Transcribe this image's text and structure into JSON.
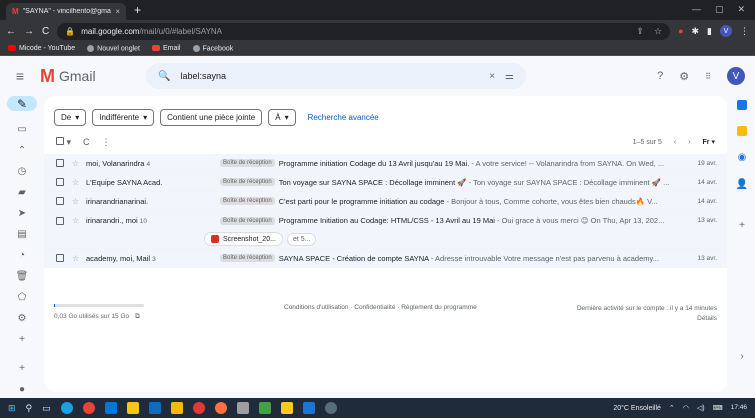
{
  "browser": {
    "tab_title": "\"SAYNA\" - vincilhento@gmail.co",
    "tab_close": "×",
    "new_tab": "+",
    "url_host": "mail.google.com",
    "url_path": "/mail/u/0/#label/SAYNA",
    "nav_back": "←",
    "nav_forward": "→",
    "nav_reload": "C",
    "profile_initial": "V",
    "bookmarks": [
      {
        "label": "Micode - YouTube",
        "color": "#ff0000"
      },
      {
        "label": "Nouvel onglet",
        "color": "#9aa0a6"
      },
      {
        "label": "Email",
        "color": "#ea4335"
      },
      {
        "label": "Facebook",
        "color": "#9aa0a6"
      }
    ]
  },
  "gmail": {
    "menu_icon": "≡",
    "logo_text": "Gmail",
    "search_query": "label:sayna",
    "search_clear": "×",
    "search_options": "⚌",
    "help_icon": "?",
    "settings_icon": "⚙",
    "apps_icon": "⋮⋮⋮",
    "avatar_initial": "V"
  },
  "filters": {
    "from": "De",
    "read_state": "Indifférente",
    "has_attachment": "Contient une pièce jointe",
    "to": "À",
    "advanced": "Recherche avancée"
  },
  "toolbar": {
    "refresh": "C",
    "more": "⋮",
    "range": "1–5 sur 5",
    "lang": "Fr"
  },
  "emails": [
    {
      "sender": "moi, Volanarindra",
      "count": "4",
      "label": "Boîte de réception",
      "subject": "Programme initiation Codage du 13 Avril jusqu'au 19 Mai.",
      "snippet": " - A votre service! -- Volanarindra from SAYNA. On Wed, ...",
      "date": "19 avr."
    },
    {
      "sender": "L'Equipe SAYNA Acad.",
      "count": "",
      "label": "Boîte de réception",
      "subject": "Ton voyage sur SAYNA SPACE : Décollage imminent 🚀",
      "snippet": " - Ton voyage sur SAYNA SPACE : Décollage imminent 🚀 ...",
      "date": "14 avr."
    },
    {
      "sender": "irinarandrianarinai.",
      "count": "",
      "label": "Boîte de réception",
      "subject": "C'est parti pour le programme initiation au codage",
      "snippet": " - Bonjour à tous, Comme cohorte, vous êtes bien chauds🔥 V...",
      "date": "14 avr."
    },
    {
      "sender": "irinarandri., moi",
      "count": "10",
      "label": "Boîte de réception",
      "subject": "Programme Initiation au Codage: HTML/CSS - 13 Avril au 19 Mai",
      "snippet": " - Oui grace à vous merci 😊 On Thu, Apr 13, 202...",
      "date": "13 avr."
    },
    {
      "sender": "academy, moi, Mail",
      "count": "3",
      "label": "Boîte de réception",
      "subject": "SAYNA SPACE - Création de compte SAYNA",
      "snippet": " - Adresse introuvable Votre message n'est pas parvenu à academy...",
      "date": "13 avr."
    }
  ],
  "attachment": {
    "name": "Screenshot_20...",
    "more": "et 5..."
  },
  "footer": {
    "storage": "0,03 Go utilisés sur 15 Go",
    "storage_fraction": 0.002,
    "links": "Conditions d'utilisation · Confidentialité · Règlement du programme",
    "activity": "Dernière activité sur le compte : il y a 14 minutes",
    "details": "Détails"
  },
  "rail_icons": [
    "pencil-icon",
    "inbox-icon",
    "chevron-up-icon",
    "snoozed-icon",
    "important-icon",
    "sent-icon",
    "drafts-icon",
    "scheduled-icon",
    "trash-icon",
    "label-icon",
    "settings-icon",
    "plus-icon"
  ],
  "taskbar": {
    "time": "17:46",
    "weather": "20°C Ensoleillé"
  }
}
